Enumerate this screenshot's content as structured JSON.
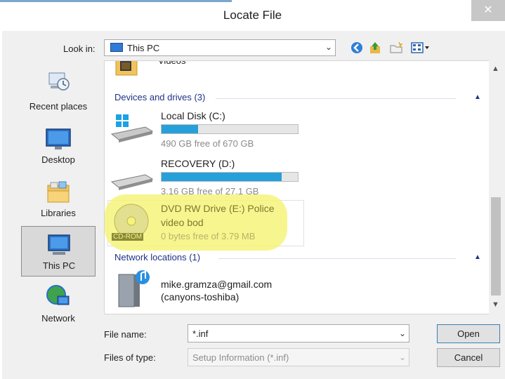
{
  "window": {
    "title": "Locate File",
    "close_glyph": "✕"
  },
  "toolbar": {
    "lookin_label": "Look in:",
    "lookin_value": "This PC",
    "icons": [
      "back-icon",
      "up-folder-icon",
      "new-folder-icon",
      "view-menu-icon"
    ]
  },
  "places": [
    {
      "label": "Recent places",
      "icon": "recent-places-icon"
    },
    {
      "label": "Desktop",
      "icon": "desktop-icon"
    },
    {
      "label": "Libraries",
      "icon": "libraries-icon"
    },
    {
      "label": "This PC",
      "icon": "this-pc-icon",
      "selected": true
    },
    {
      "label": "Network",
      "icon": "network-icon"
    }
  ],
  "filelist": {
    "partial_item": "Videos",
    "groups": [
      {
        "header": "Devices and drives (3)",
        "items": [
          {
            "name": "Local Disk (C:)",
            "free": "490 GB free of 670 GB",
            "used_fraction": 0.27
          },
          {
            "name": "RECOVERY (D:)",
            "free": "3.16 GB free of 27.1 GB",
            "used_fraction": 0.88
          },
          {
            "name_line1": "DVD RW Drive (E:) Police",
            "name_line2": "video bod",
            "free": "0 bytes free of 3.79 MB",
            "badge": "CD-ROM"
          }
        ]
      },
      {
        "header": "Network locations (1)",
        "items": [
          {
            "name_line1": "mike.gramza@gmail.com",
            "name_line2": "(canyons-toshiba)"
          }
        ]
      }
    ]
  },
  "form": {
    "filename_label": "File name:",
    "filename_value": "*.inf",
    "filetype_label": "Files of type:",
    "filetype_value": "Setup Information (*.inf)",
    "open_label": "Open",
    "cancel_label": "Cancel"
  },
  "colors": {
    "accent": "#26a0da",
    "group_header": "#1e3287",
    "highlight": "#f6f37a"
  }
}
